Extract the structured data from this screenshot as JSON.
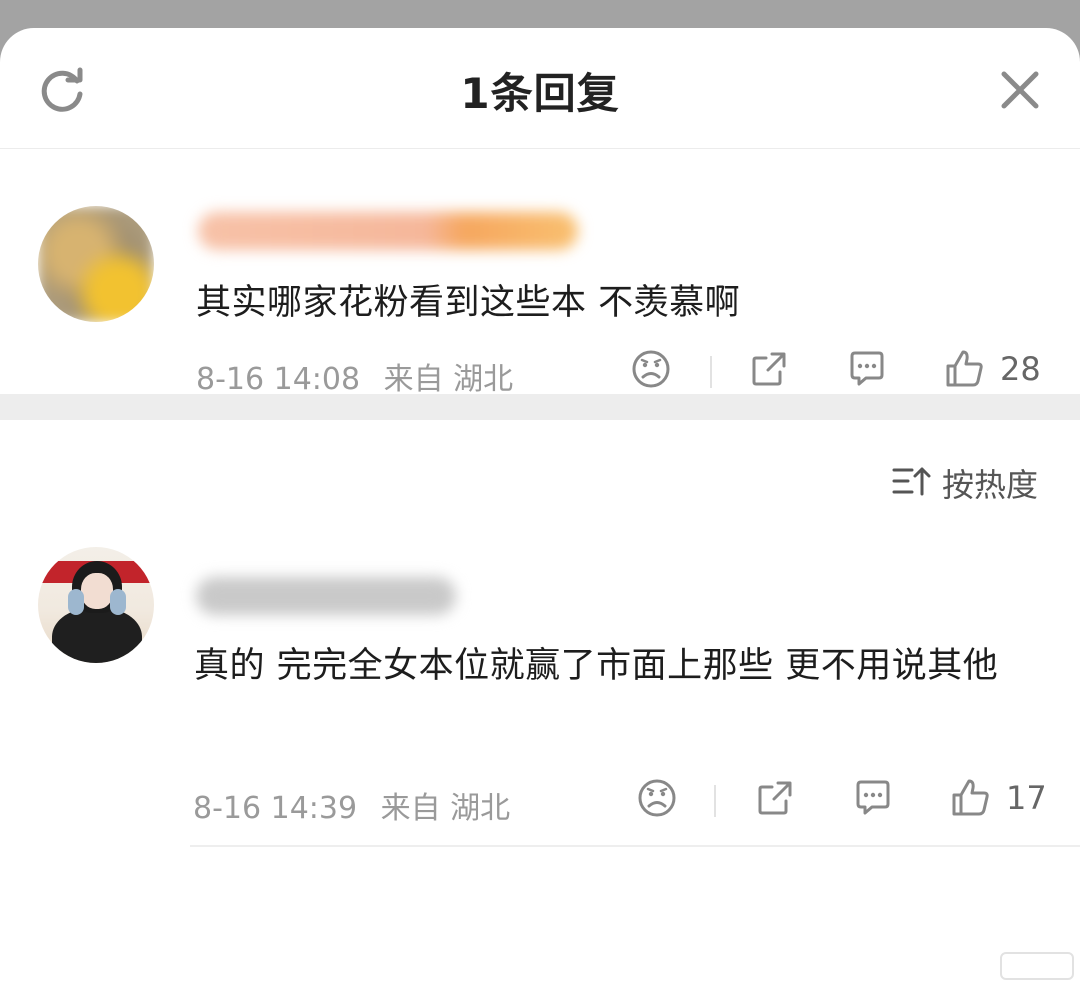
{
  "header": {
    "title": "1条回复"
  },
  "comments": [
    {
      "text": "其实哪家花粉看到这些本 不羡慕啊",
      "time": "8-16 14:08",
      "location": "来自 湖北",
      "likes": "28"
    },
    {
      "text": "真的 完完全女本位就赢了市面上那些 更不用说其他",
      "time": "8-16 14:39",
      "location": "来自 湖北",
      "likes": "17"
    }
  ],
  "sort": {
    "label": "按热度"
  },
  "icons": {
    "refresh": "refresh-icon",
    "close": "close-icon",
    "sad": "sad-face-icon",
    "share": "share-icon",
    "comment": "comment-icon",
    "like": "thumbs-up-icon",
    "sort": "sort-icon"
  },
  "colors": {
    "accent_gray": "#9a9a9a",
    "text": "#1d1d1d",
    "gap": "#ededed"
  }
}
